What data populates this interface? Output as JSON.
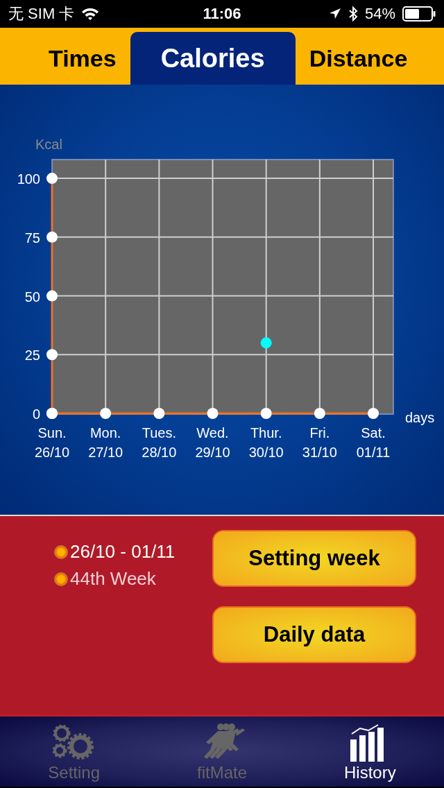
{
  "status_bar": {
    "carrier": "无 SIM 卡",
    "time": "11:06",
    "battery": "54%"
  },
  "tabs": [
    {
      "label": "Times",
      "selected": false
    },
    {
      "label": "Calories",
      "selected": true
    },
    {
      "label": "Distance",
      "selected": false
    }
  ],
  "chart_data": {
    "type": "line",
    "ylabel": "Kcal",
    "xlabel": "days",
    "categories": [
      "Sun.\n26/10",
      "Mon.\n27/10",
      "Tues.\n28/10",
      "Wed.\n29/10",
      "Thur.\n30/10",
      "Fri.\n31/10",
      "Sat.\n01/11"
    ],
    "grid": true,
    "series": [
      {
        "color": "#f07020",
        "marker": "o",
        "values": [
          0,
          0,
          0,
          0,
          0,
          0,
          0
        ]
      },
      {
        "color": "#00ffff",
        "marker": "o",
        "values": [
          null,
          null,
          null,
          null,
          30,
          null,
          null
        ]
      }
    ],
    "ylim": [
      0,
      108
    ],
    "yticks": [
      0,
      25,
      50,
      75,
      100
    ]
  },
  "week_info": [
    {
      "text": "26/10 - 01/11"
    },
    {
      "text": "44th Week"
    }
  ],
  "buttons": [
    "Setting week",
    "Daily data"
  ],
  "nav": [
    {
      "label": "Setting",
      "kind": "gears",
      "selected": false
    },
    {
      "label": "fitMate",
      "kind": "runners",
      "selected": false
    },
    {
      "label": "History",
      "kind": "chart",
      "selected": true
    }
  ]
}
